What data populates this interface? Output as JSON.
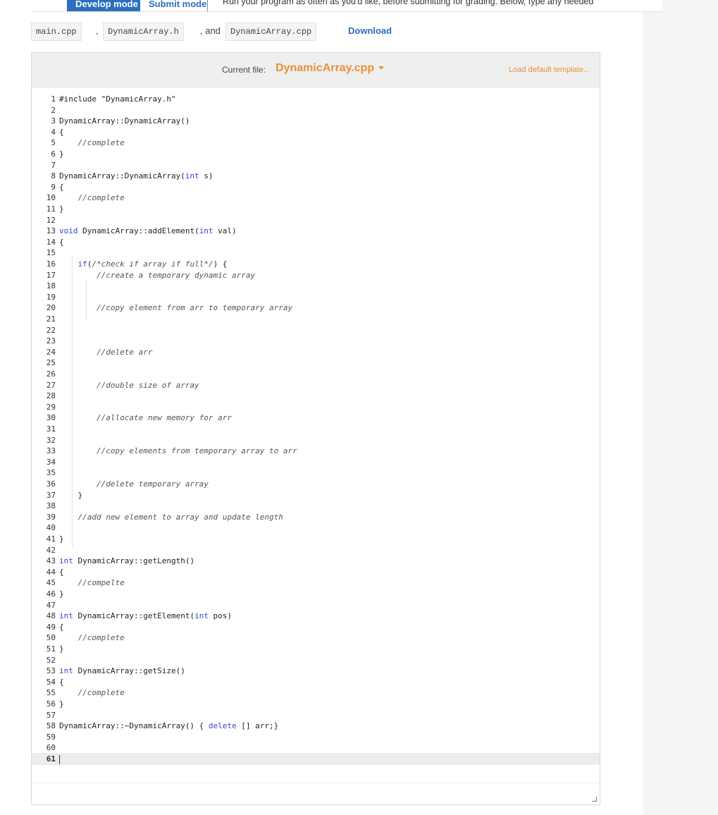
{
  "top": {
    "develop_mode": "Develop mode",
    "submit_mode": "Submit mode",
    "hint": "Run your program as often as you'd like, before submitting for grading. Below, type any needed"
  },
  "files": {
    "file1": "main.cpp",
    "sep1": ",",
    "file2": "DynamicArray.h",
    "sep2": ", and",
    "file3": "DynamicArray.cpp",
    "download": "Download"
  },
  "editor": {
    "current_file_label": "Current file:",
    "current_file": "DynamicArray.cpp",
    "load_default": "Load default template..."
  },
  "code_lines": [
    "#include \"DynamicArray.h\"",
    "",
    "DynamicArray::DynamicArray()",
    "{",
    "    //complete",
    "}",
    "",
    "DynamicArray::DynamicArray(int s)",
    "{",
    "    //complete",
    "}",
    "",
    "void DynamicArray::addElement(int val)",
    "{",
    "",
    "    if(/*check if array if full*/) {",
    "        //create a temporary dynamic array",
    "",
    "",
    "        //copy element from arr to temporary array",
    "",
    "",
    "",
    "        //delete arr",
    "",
    "",
    "        //double size of array",
    "",
    "",
    "        //allocate new memory for arr",
    "",
    "",
    "        //copy elements from temporary array to arr",
    "",
    "",
    "        //delete temporary array",
    "    }",
    "",
    "    //add new element to array and update length",
    "",
    "}",
    "",
    "int DynamicArray::getLength()",
    "{",
    "    //compelte",
    "}",
    "",
    "int DynamicArray::getElement(int pos)",
    "{",
    "    //complete",
    "}",
    "",
    "int DynamicArray::getSize()",
    "{",
    "    //complete",
    "}",
    "",
    "DynamicArray::~DynamicArray() { delete [] arr;}",
    "",
    "",
    ""
  ],
  "active_line": 61
}
